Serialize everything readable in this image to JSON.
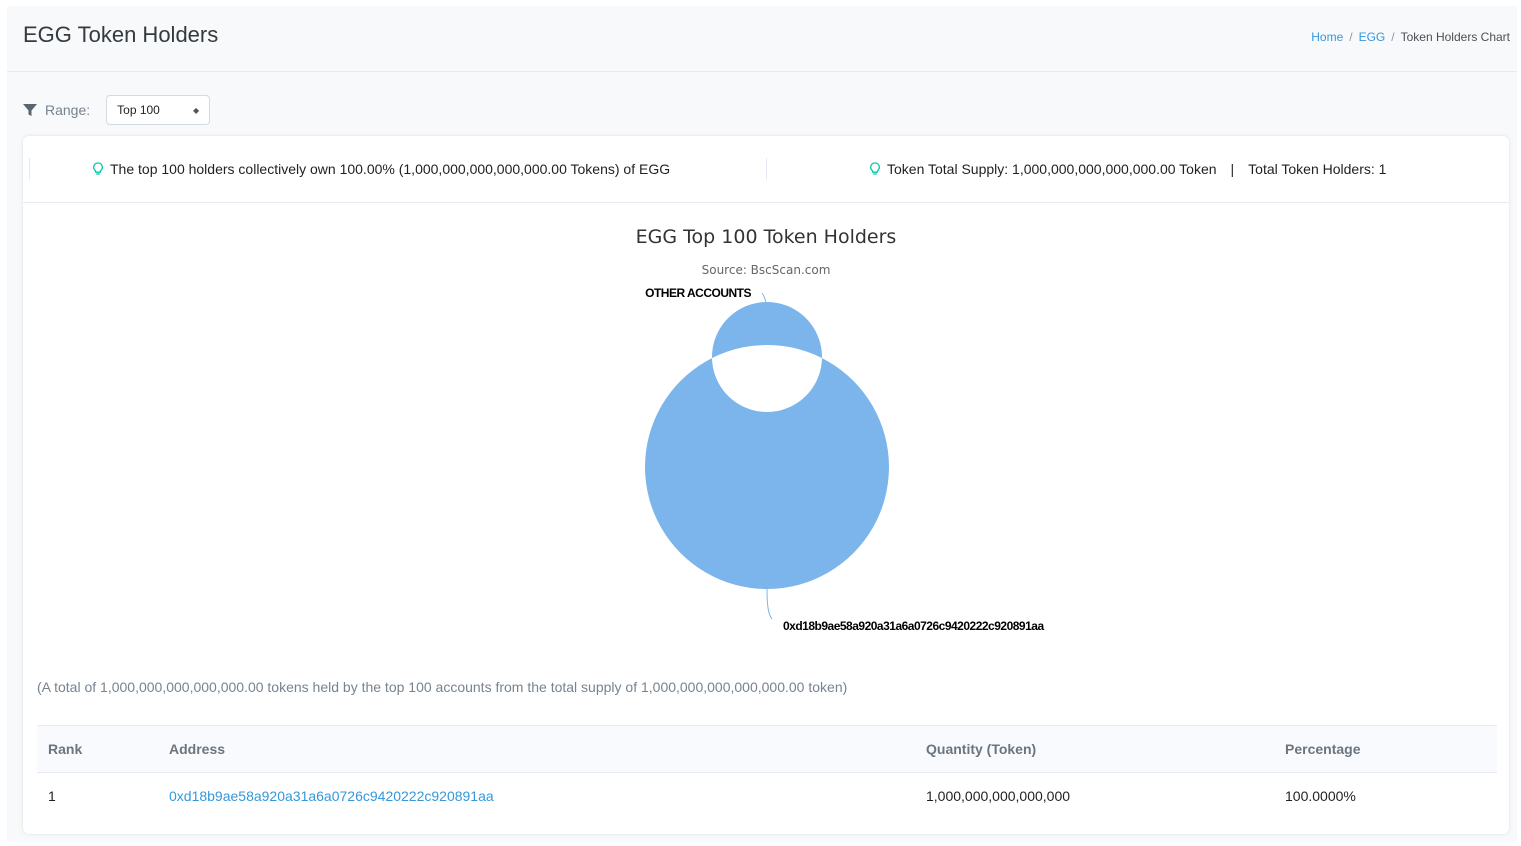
{
  "header": {
    "title": "EGG Token Holders",
    "breadcrumb": [
      "Home",
      "EGG",
      "Token Holders Chart"
    ]
  },
  "filter": {
    "range_label": "Range:",
    "range_value": "Top 100"
  },
  "summary": {
    "left": "The top 100 holders collectively own 100.00% (1,000,000,000,000,000.00 Tokens) of EGG",
    "supply": "Token Total Supply: 1,000,000,000,000,000.00 Token",
    "holders": "Total Token Holders: 1"
  },
  "chart_data": {
    "type": "pie",
    "title": "EGG Top 100 Token Holders",
    "subtitle": "Source: BscScan.com",
    "donut": true,
    "labels": [
      "0xd18b9ae58a920a31a6a0726c9420222c920891aa",
      "OTHER ACCOUNTS"
    ],
    "values": [
      100,
      0
    ],
    "colors": [
      "#7cb5ec",
      "#434348"
    ]
  },
  "total_note": "(A total of 1,000,000,000,000,000.00 tokens held by the top 100 accounts from the total supply of 1,000,000,000,000,000.00 token)",
  "table": {
    "headers": [
      "Rank",
      "Address",
      "Quantity (Token)",
      "Percentage"
    ],
    "rows": [
      {
        "rank": "1",
        "address": "0xd18b9ae58a920a31a6a0726c9420222c920891aa",
        "quantity": "1,000,000,000,000,000",
        "percentage": "100.0000%"
      }
    ]
  },
  "colors": {
    "link": "#3498db",
    "accent_bulb": "#00c9a7"
  }
}
